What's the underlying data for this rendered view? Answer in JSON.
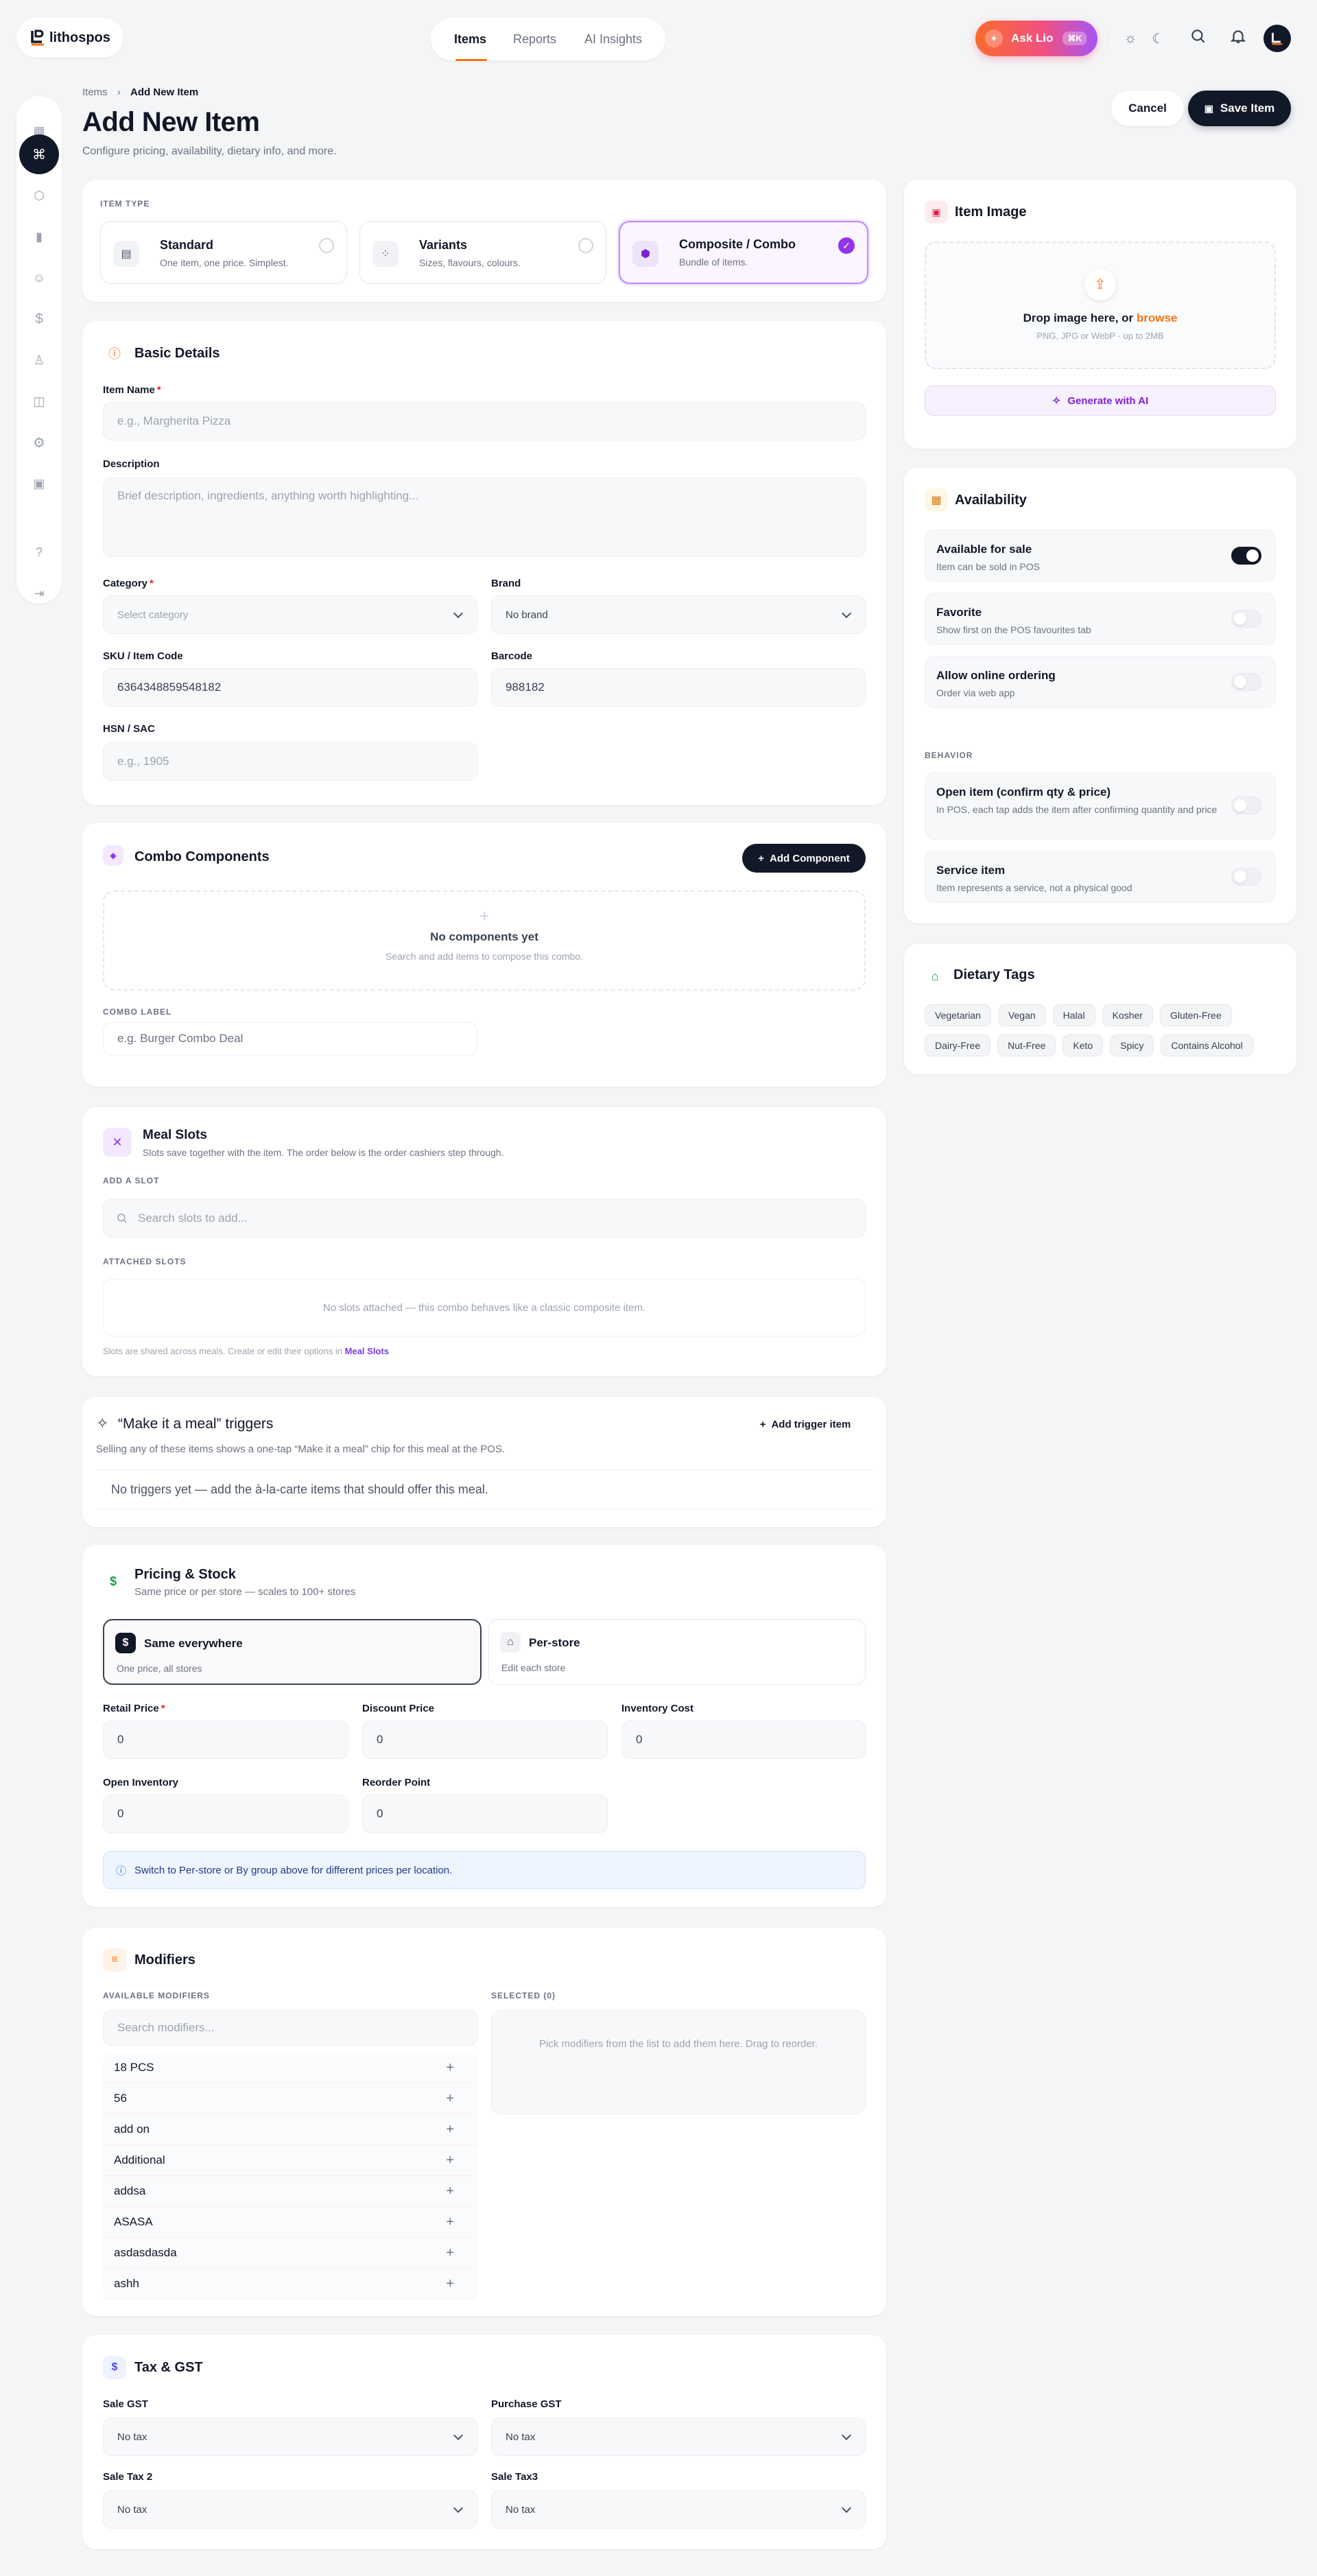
{
  "brand": {
    "name": "lithospos"
  },
  "topnav": {
    "tabs": [
      {
        "label": "Items",
        "active": true
      },
      {
        "label": "Reports",
        "active": false
      },
      {
        "label": "AI Insights",
        "active": false
      }
    ]
  },
  "ask": {
    "label": "Ask Lio",
    "shortcut": "⌘K"
  },
  "breadcrumb": {
    "parent": "Items",
    "current": "Add New Item"
  },
  "page": {
    "title": "Add New Item",
    "subtitle": "Configure pricing, availability, dietary info, and more.",
    "cancel": "Cancel",
    "save": "Save Item"
  },
  "item_type": {
    "label": "ITEM TYPE",
    "options": [
      {
        "title": "Standard",
        "desc": "One item, one price. Simplest.",
        "selected": false
      },
      {
        "title": "Variants",
        "desc": "Sizes, flavours, colours.",
        "selected": false
      },
      {
        "title": "Composite / Combo",
        "desc": "Bundle of items.",
        "selected": true
      }
    ]
  },
  "basic": {
    "title": "Basic Details",
    "name_label": "Item Name",
    "name_placeholder": "e.g., Margherita Pizza",
    "desc_label": "Description",
    "desc_placeholder": "Brief description, ingredients, anything worth highlighting...",
    "category_label": "Category",
    "category_placeholder": "Select category",
    "brand_label": "Brand",
    "brand_value": "No brand",
    "sku_label": "SKU / Item Code",
    "sku_value": "6364348859548182",
    "barcode_label": "Barcode",
    "barcode_value": "988182",
    "hsn_label": "HSN / SAC",
    "hsn_placeholder": "e.g., 1905"
  },
  "combo": {
    "title": "Combo Components",
    "add": "Add Component",
    "empty_title": "No components yet",
    "empty_desc": "Search and add items to compose this combo.",
    "label_label": "COMBO LABEL",
    "label_placeholder": "e.g. Burger Combo Deal"
  },
  "meal": {
    "title": "Meal Slots",
    "desc": "Slots save together with the item. The order below is the order cashiers step through.",
    "add_label": "ADD A SLOT",
    "search_placeholder": "Search slots to add...",
    "attached_label": "ATTACHED SLOTS",
    "attached_empty": "No slots attached — this combo behaves like a classic composite item.",
    "footer": "Slots are shared across meals. Create or edit their options in",
    "footer_link": "Meal Slots"
  },
  "triggers": {
    "title": "“Make it a meal” triggers",
    "desc": "Selling any of these items shows a one-tap “Make it a meal” chip for this meal at the POS.",
    "add": "Add trigger item",
    "empty": "No triggers yet — add the à-la-carte items that should offer this meal."
  },
  "pricing": {
    "title": "Pricing & Stock",
    "desc": "Same price or per store — scales to 100+ stores",
    "mode1_title": "Same everywhere",
    "mode1_desc": "One price, all stores",
    "mode2_title": "Per-store",
    "mode2_desc": "Edit each store",
    "retail_label": "Retail Price",
    "retail_value": "0",
    "discount_label": "Discount Price",
    "discount_value": "0",
    "cost_label": "Inventory Cost",
    "cost_value": "0",
    "open_label": "Open Inventory",
    "open_value": "0",
    "reorder_label": "Reorder Point",
    "reorder_value": "0",
    "info": "Switch to Per-store or By group above for different prices per location."
  },
  "modifiers": {
    "title": "Modifiers",
    "available_label": "AVAILABLE MODIFIERS",
    "search_placeholder": "Search modifiers...",
    "selected_label": "SELECTED (0)",
    "selected_empty": "Pick modifiers from the list to add them here. Drag to reorder.",
    "items": [
      "18 PCS",
      "56",
      "add on",
      "Additional",
      "addsa",
      "ASASA",
      "asdasdasda",
      "ashh"
    ]
  },
  "tax": {
    "title": "Tax & GST",
    "sale_gst_label": "Sale GST",
    "sale_gst": "No tax",
    "purchase_gst_label": "Purchase GST",
    "purchase_gst": "No tax",
    "sale_tax2_label": "Sale Tax 2",
    "sale_tax2": "No tax",
    "sale_tax3_label": "Sale Tax3",
    "sale_tax3": "No tax"
  },
  "image": {
    "title": "Item Image",
    "drop": "Drop image here, or",
    "browse": "browse",
    "hint": "PNG, JPG or WebP · up to 2MB",
    "ai": "Generate with AI"
  },
  "availability": {
    "title": "Availability",
    "rows": [
      {
        "title": "Available for sale",
        "desc": "Item can be sold in POS",
        "on": true
      },
      {
        "title": "Favorite",
        "desc": "Show first on the POS favourites tab",
        "on": false
      },
      {
        "title": "Allow online ordering",
        "desc": "Order via web app",
        "on": false
      }
    ],
    "behavior_label": "BEHAVIOR",
    "behavior": [
      {
        "title": "Open item (confirm qty & price)",
        "desc": "In POS, each tap adds the item after confirming quantity and price",
        "on": false
      },
      {
        "title": "Service item",
        "desc": "Item represents a service, not a physical good",
        "on": false
      }
    ]
  },
  "dietary": {
    "title": "Dietary Tags",
    "tags": [
      "Vegetarian",
      "Vegan",
      "Halal",
      "Kosher",
      "Gluten-Free",
      "Dairy-Free",
      "Nut-Free",
      "Keto",
      "Spicy",
      "Contains Alcohol"
    ]
  },
  "colors": {
    "accent": "#f97316",
    "dark": "#111827",
    "purple": "#a855f7"
  }
}
